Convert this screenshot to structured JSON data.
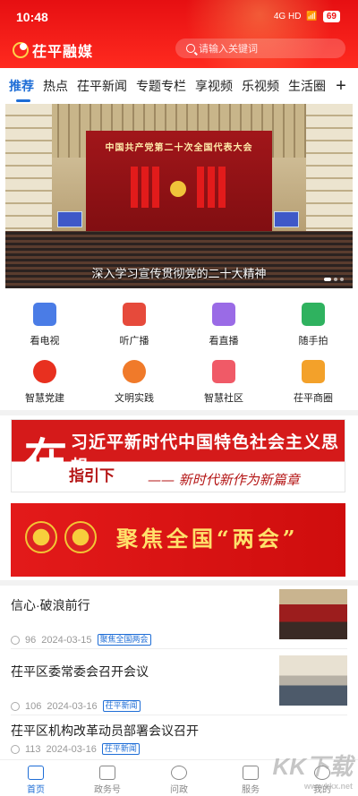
{
  "status": {
    "time": "10:48",
    "network": "4G HD",
    "battery": "69"
  },
  "app": {
    "name": "茌平融媒",
    "search_placeholder": "请输入关键词"
  },
  "tabs": [
    "推荐",
    "热点",
    "茌平新闻",
    "专题专栏",
    "享视频",
    "乐视频",
    "生活圈"
  ],
  "tab_more": "+",
  "banner": {
    "stage_text": "中国共产党第二十次全国代表大会",
    "caption": "深入学习宣传贯彻党的二十大精神"
  },
  "grid": [
    {
      "label": "看电视",
      "icon": "tv-icon",
      "color": "#4a7ce6"
    },
    {
      "label": "听广播",
      "icon": "radio-icon",
      "color": "#e64a3b"
    },
    {
      "label": "看直播",
      "icon": "live-video-icon",
      "color": "#9a6be6"
    },
    {
      "label": "随手拍",
      "icon": "clapboard-icon",
      "color": "#2fb25f"
    },
    {
      "label": "智慧党建",
      "icon": "party-emblem-icon",
      "color": "#e8301f"
    },
    {
      "label": "文明实践",
      "icon": "flower-icon",
      "color": "#f07a2a"
    },
    {
      "label": "智慧社区",
      "icon": "community-icon",
      "color": "#f05a67"
    },
    {
      "label": "茌平商圈",
      "icon": "book-icon",
      "color": "#f3a12a"
    }
  ],
  "promo1": {
    "big": "在",
    "line1": "习近平新时代中国特色社会主义思想",
    "line2": "指引下",
    "line3": "—— 新时代新作为新篇章"
  },
  "promo2": {
    "title": "聚焦全国“两会”"
  },
  "news": [
    {
      "title": "信心·破浪前行",
      "views": "96",
      "date": "2024-03-15",
      "tag": "聚焦全国两会"
    },
    {
      "title": "茌平区委常委会召开会议",
      "views": "106",
      "date": "2024-03-16",
      "tag": "茌平新闻"
    },
    {
      "title": "茌平区机构改革动员部署会议召开",
      "views": "113",
      "date": "2024-03-16",
      "tag": "茌平新闻"
    }
  ],
  "bottom_nav": [
    "首页",
    "政务号",
    "问政",
    "服务",
    "我的"
  ],
  "watermark": {
    "main": "KK下载",
    "sub": "www.kkx.net"
  }
}
